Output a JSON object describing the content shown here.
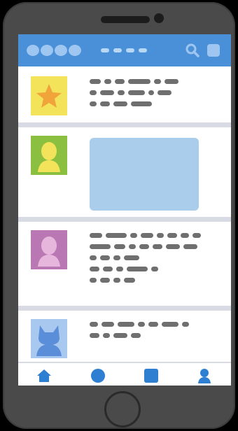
{
  "colors": {
    "device_body": "#4a4a4a",
    "app_bar": "#4a90d9",
    "app_bar_light": "#9ec6f0",
    "separator": "#d8dbe3",
    "placeholder_text": "#6f6f6f",
    "nav_icon": "#2e7fd1"
  },
  "app_bar": {
    "logo": "logo-placeholder",
    "tabs": "tab-placeholders",
    "icons": [
      "search-icon",
      "grid-icon"
    ]
  },
  "feed": {
    "posts": [
      {
        "avatar": "star-icon",
        "avatar_bg": "#f3e35b",
        "avatar_fg": "#f0a43a",
        "content": "text"
      },
      {
        "avatar": "person-silhouette-icon",
        "avatar_bg": "#8bbf3f",
        "avatar_fg": "#f3e35b",
        "content": "image"
      },
      {
        "avatar": "person-silhouette-icon",
        "avatar_bg": "#b978b4",
        "avatar_fg": "#e6b6dc",
        "content": "text"
      },
      {
        "avatar": "cat-silhouette-icon",
        "avatar_bg": "#a8c8ef",
        "avatar_fg": "#5b8ed8",
        "content": "text"
      }
    ]
  },
  "bottom_nav": {
    "items": [
      "home-icon",
      "circle-icon",
      "square-icon",
      "profile-icon"
    ]
  }
}
